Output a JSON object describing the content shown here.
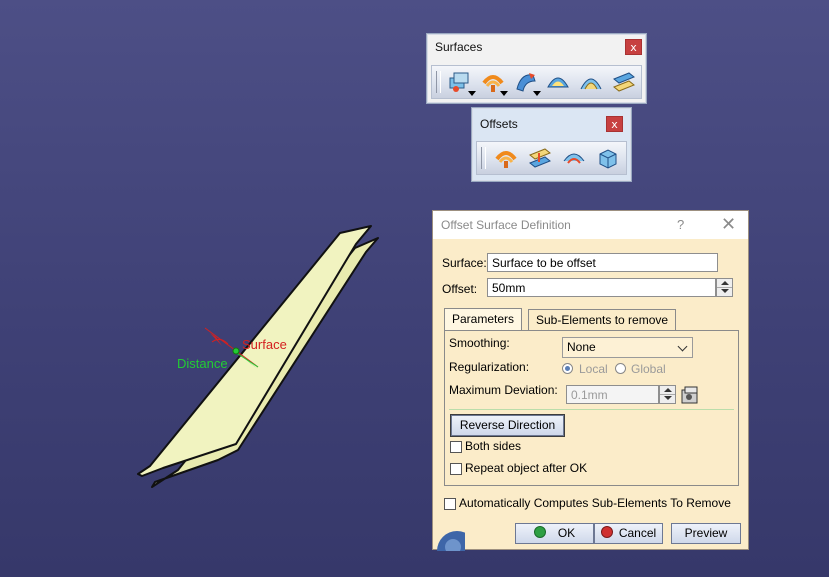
{
  "viewport": {
    "surface_label": "Surface",
    "distance_label": "Distance",
    "colors": {
      "surface_fill": "#eef0b8",
      "surface_label": "#d42020",
      "distance_label": "#22cc33"
    }
  },
  "surfaces_toolbar": {
    "title": "Surfaces",
    "close": "x",
    "icons": [
      "extrude-icon",
      "offset-icon",
      "sweep-icon",
      "fill-icon",
      "multi-section-icon",
      "blend-icon"
    ]
  },
  "offsets_toolbar": {
    "title": "Offsets",
    "close": "x",
    "icons": [
      "offset-icon",
      "variable-offset-icon",
      "rough-offset-icon",
      "rough-solid-icon"
    ]
  },
  "dialog": {
    "title": "Offset Surface Definition",
    "help": "?",
    "close": "✕",
    "surface_label": "Surface:",
    "surface_value": "Surface to be offset",
    "offset_label": "Offset:",
    "offset_value": "50mm",
    "tabs": [
      "Parameters",
      "Sub-Elements to remove"
    ],
    "smoothing_label": "Smoothing:",
    "smoothing_value": "None",
    "regularization_label": "Regularization:",
    "local_label": "Local",
    "global_label": "Global",
    "max_dev_label": "Maximum Deviation:",
    "max_dev_value": "0.1mm",
    "reverse_label": "Reverse Direction",
    "both_sides_label": "Both sides",
    "repeat_label": "Repeat object after OK",
    "auto_label": "Automatically Computes Sub-Elements To Remove",
    "ok_label": "OK",
    "cancel_label": "Cancel",
    "preview_label": "Preview",
    "colors": {
      "background": "#fbecc9",
      "ok_dot": "#2ea043",
      "cancel_dot": "#d03030"
    }
  }
}
